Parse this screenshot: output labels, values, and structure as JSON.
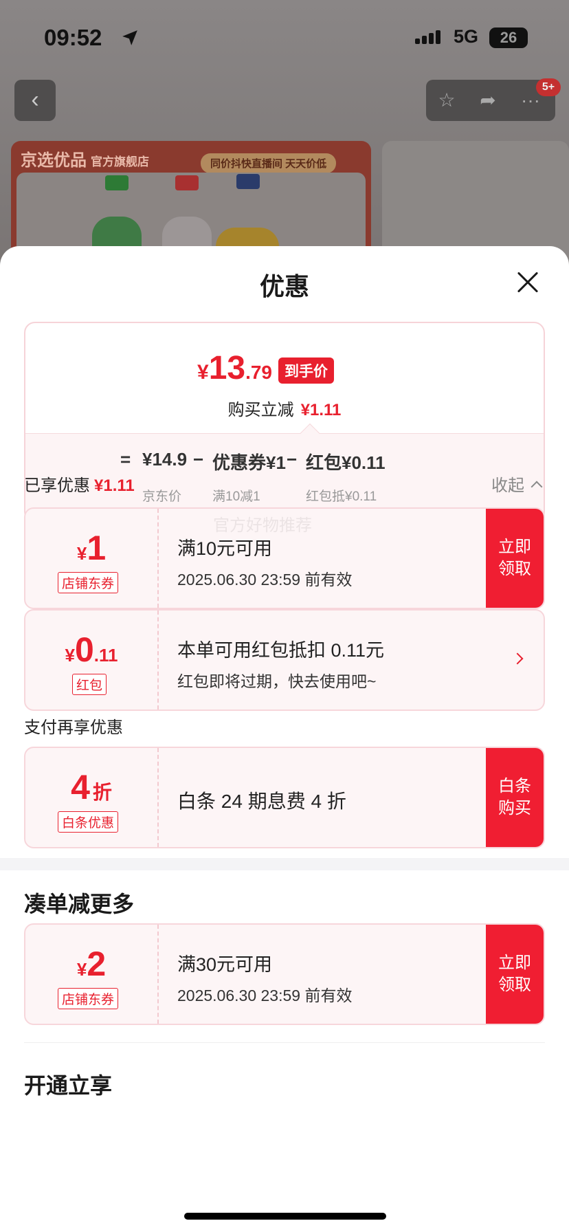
{
  "status_bar": {
    "time": "09:52",
    "network": "5G",
    "battery": "26"
  },
  "top_nav": {
    "badge": "5+"
  },
  "banner": {
    "brand": "京选优品",
    "brand_sub": "官方旗舰店",
    "slogan": "同价抖快直播间 天天价低"
  },
  "sheet": {
    "title": "优惠",
    "final_price": {
      "symbol": "¥",
      "integer": "13",
      "decimal": ".79",
      "tag": "到手价"
    },
    "reduce_label": "购买立减",
    "reduce_value": "¥1.11",
    "formula": {
      "equals": "=",
      "minus": "−",
      "items": [
        {
          "value": "¥14.9",
          "label": "京东价"
        },
        {
          "value": "优惠券¥1",
          "label": "满10减1"
        },
        {
          "value": "红包¥0.11",
          "label": "红包抵¥0.11"
        }
      ]
    },
    "enjoyed": {
      "label": "已享优惠",
      "value": "¥1.11",
      "collapse": "收起"
    },
    "watermark": "官方好物推荐",
    "coupons": [
      {
        "symbol": "¥",
        "value": "1",
        "tag": "店铺东券",
        "main": "满10元可用",
        "sub": "2025.06.30 23:59 前有效",
        "button": "立即领取"
      },
      {
        "symbol": "¥",
        "value": "0",
        "decimal": ".11",
        "tag": "红包",
        "main": "本单可用红包抵扣 0.11元",
        "sub": "红包即将过期，快去使用吧~"
      }
    ],
    "payment": {
      "label": "支付再享优惠",
      "value": "4",
      "unit": "折",
      "tag": "白条优惠",
      "main": "白条 24 期息费 4 折",
      "button": "白条购买"
    },
    "more": {
      "title": "凑单减更多",
      "coupon": {
        "symbol": "¥",
        "value": "2",
        "tag": "店铺东券",
        "main": "满30元可用",
        "sub": "2025.06.30 23:59 前有效",
        "button": "立即领取"
      }
    },
    "vip_title": "开通立享"
  },
  "colors": {
    "accent": "#e8202e",
    "button": "#f01e32",
    "coupon_bg": "#fdf5f6"
  }
}
